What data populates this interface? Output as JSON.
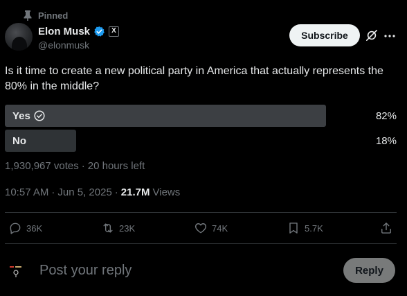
{
  "pinned": {
    "label": "Pinned",
    "icon": "pin-icon"
  },
  "author": {
    "name": "Elon Musk",
    "handle": "@elonmusk",
    "verified_color": "#1d9bf0",
    "affiliation_badge": "X"
  },
  "header_actions": {
    "subscribe_label": "Subscribe",
    "grok_icon": "grok-icon",
    "more_icon": "more-dots-icon"
  },
  "post": {
    "text": "Is it time to create a new political party in America that actually represents the 80% in the middle?"
  },
  "poll": {
    "options": [
      {
        "label": "Yes",
        "percent_label": "82%",
        "percent": 82,
        "winner": true
      },
      {
        "label": "No",
        "percent_label": "18%",
        "percent": 18,
        "winner": false
      }
    ],
    "votes": "1,930,967 votes",
    "separator": "·",
    "time_left": "20 hours left"
  },
  "meta": {
    "time": "10:57 AM",
    "separator": "·",
    "date": "Jun 5, 2025",
    "views_count": "21.7M",
    "views_label": "Views"
  },
  "actions": {
    "replies": "36K",
    "reposts": "23K",
    "likes": "74K",
    "bookmarks": "5.7K"
  },
  "composer": {
    "placeholder": "Post your reply",
    "reply_label": "Reply"
  },
  "colors": {
    "background": "#000000",
    "text": "#e7e9ea",
    "muted": "#71767b",
    "divider": "#2f3336",
    "poll_winner": "#3c3f43",
    "poll_other": "#2f3336"
  }
}
